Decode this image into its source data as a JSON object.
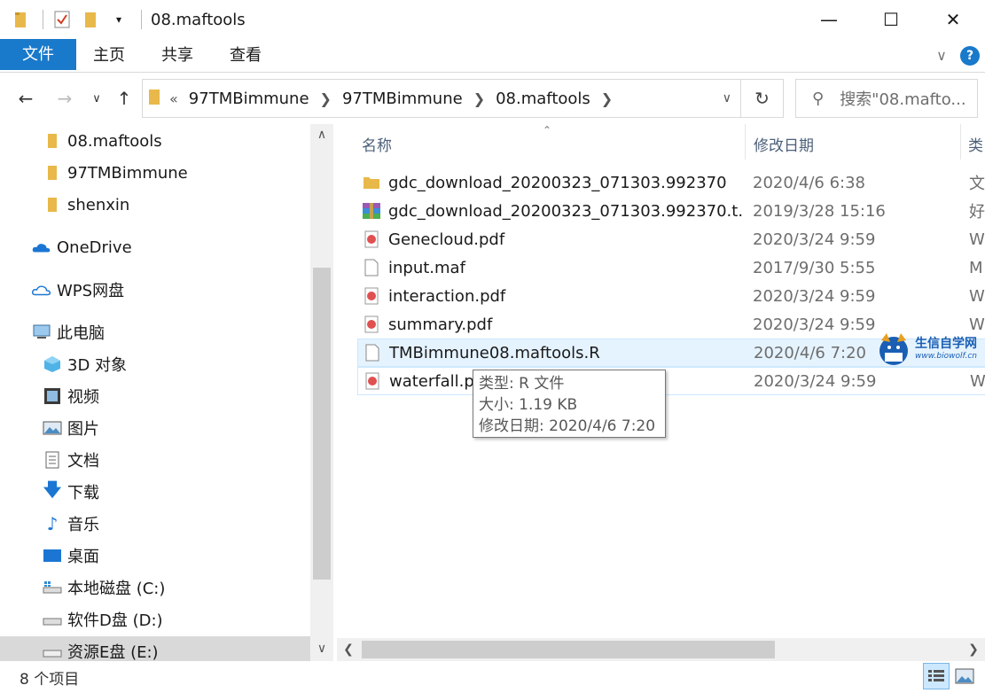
{
  "window": {
    "title": "08.maftools"
  },
  "ribbon": {
    "tabs": [
      "文件",
      "主页",
      "共享",
      "查看"
    ]
  },
  "address": {
    "overflow": "«",
    "crumbs": [
      "97TMBimmune",
      "97TMBimmune",
      "08.maftools"
    ]
  },
  "search": {
    "placeholder": "搜索\"08.mafto..."
  },
  "navpane": {
    "items": [
      {
        "label": "08.maftools",
        "icon": "folder-icon"
      },
      {
        "label": "97TMBimmune",
        "icon": "folder-icon"
      },
      {
        "label": "shenxin",
        "icon": "folder-icon"
      },
      {
        "label": "OneDrive",
        "icon": "onedrive-icon"
      },
      {
        "label": "WPS网盘",
        "icon": "wps-cloud-icon"
      },
      {
        "label": "此电脑",
        "icon": "computer-icon"
      },
      {
        "label": "3D 对象",
        "icon": "3d-objects-icon"
      },
      {
        "label": "视频",
        "icon": "video-icon"
      },
      {
        "label": "图片",
        "icon": "pictures-icon"
      },
      {
        "label": "文档",
        "icon": "documents-icon"
      },
      {
        "label": "下载",
        "icon": "download-icon"
      },
      {
        "label": "音乐",
        "icon": "music-icon"
      },
      {
        "label": "桌面",
        "icon": "desktop-icon"
      },
      {
        "label": "本地磁盘 (C:)",
        "icon": "drive-c-icon"
      },
      {
        "label": "软件D盘 (D:)",
        "icon": "drive-icon"
      },
      {
        "label": "资源E盘 (E:)",
        "icon": "drive-icon"
      }
    ]
  },
  "columns": {
    "name": "名称",
    "date": "修改日期",
    "type": "类"
  },
  "files": [
    {
      "name": "gdc_download_20200323_071303.992370",
      "date": "2020/4/6 6:38",
      "type": "文",
      "icon": "folder-icon"
    },
    {
      "name": "gdc_download_20200323_071303.992370.t...",
      "date": "2019/3/28 15:16",
      "type": "好",
      "icon": "archive-icon"
    },
    {
      "name": "Genecloud.pdf",
      "date": "2020/3/24 9:59",
      "type": "W",
      "icon": "pdf-icon"
    },
    {
      "name": "input.maf",
      "date": "2017/9/30 5:55",
      "type": "M",
      "icon": "file-icon"
    },
    {
      "name": "interaction.pdf",
      "date": "2020/3/24 9:59",
      "type": "W",
      "icon": "pdf-icon"
    },
    {
      "name": "summary.pdf",
      "date": "2020/3/24 9:59",
      "type": "W",
      "icon": "pdf-icon"
    },
    {
      "name": "TMBimmune08.maftools.R",
      "date": "2020/4/6 7:20",
      "type": "",
      "icon": "file-icon"
    },
    {
      "name": "waterfall.pdf",
      "date": "2020/3/24 9:59",
      "type": "W",
      "icon": "pdf-icon"
    }
  ],
  "tooltip": {
    "type": "类型: R 文件",
    "size": "大小: 1.19 KB",
    "modified": "修改日期: 2020/4/6 7:20"
  },
  "watermark": {
    "name": "生信自学网",
    "url": "www.biowolf.cn"
  },
  "status": {
    "count": "8 个项目"
  },
  "colors": {
    "accent": "#1979ca",
    "hover": "#e5f3ff",
    "folder": "#e8b84a",
    "pdf": "#e05050"
  }
}
